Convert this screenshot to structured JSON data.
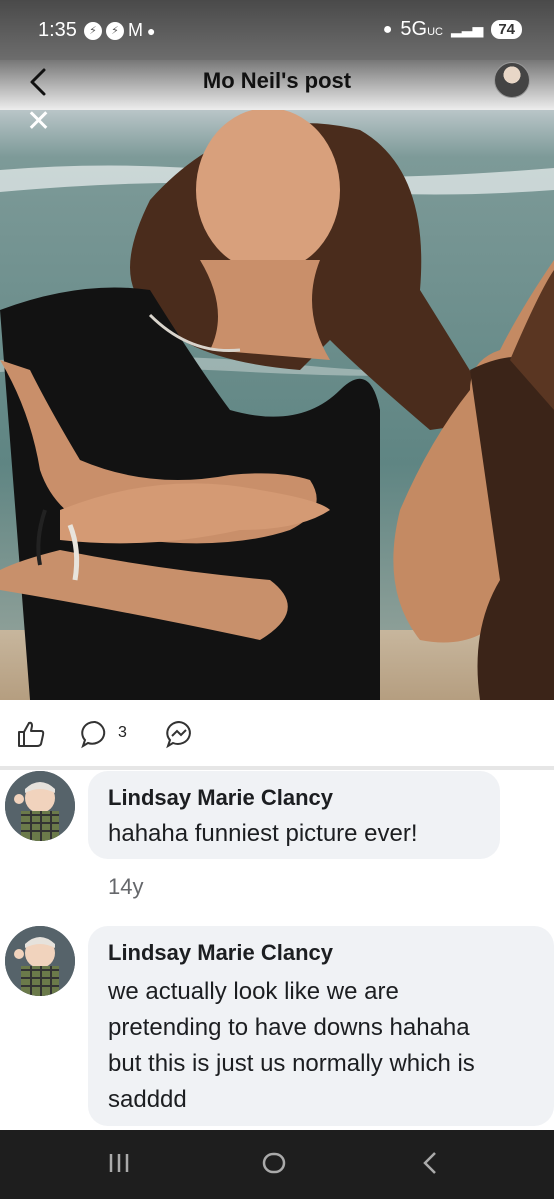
{
  "status_bar": {
    "time": "1:35",
    "notif_icons": [
      "messenger-icon",
      "messenger-icon",
      "gmail-icon"
    ],
    "network": "5G",
    "network_sub": "UC",
    "battery": "74"
  },
  "header": {
    "title": "Mo Neil's post"
  },
  "actions": {
    "comment_count": "3"
  },
  "comments": [
    {
      "author": "Lindsay Marie Clancy",
      "text": "hahaha funniest picture ever!",
      "time": "14y"
    },
    {
      "author": "Lindsay Marie Clancy",
      "text_lines": [
        "we actually look like we are",
        "pretending to have downs hahaha",
        "but this is just us normally which is",
        "sadddd"
      ]
    }
  ],
  "colors": {
    "bubble": "#f0f2f5",
    "meta": "#65676b",
    "navbar": "#1e1e1e"
  }
}
